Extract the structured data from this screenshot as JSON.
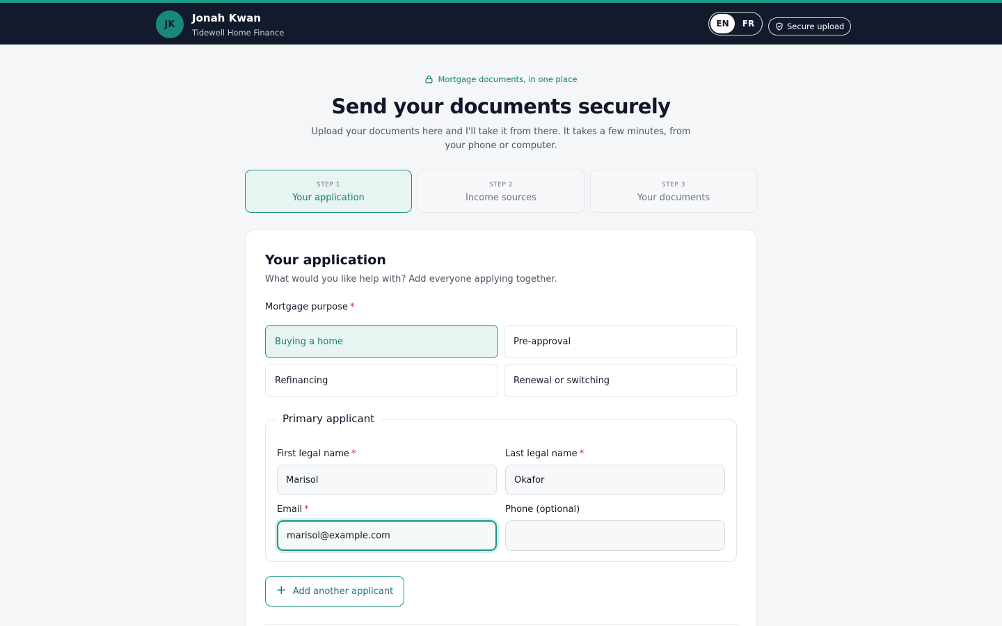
{
  "header": {
    "avatar_initials": "JK",
    "user_name": "Jonah Kwan",
    "user_org": "Tidewell Home Finance",
    "languages": [
      "EN",
      "FR"
    ],
    "active_language": "EN",
    "secure_label": "Secure upload",
    "accent_color": "#1f9e8d",
    "background_color": "#131a2b"
  },
  "hero": {
    "eyebrow": "Mortgage documents, in one place",
    "title": "Send your documents securely",
    "subtitle": "Upload your documents here and I'll take it from there. It takes a few minutes, from your phone or computer."
  },
  "steps": [
    {
      "number": "STEP 1",
      "label": "Your application",
      "active": true
    },
    {
      "number": "STEP 2",
      "label": "Income sources",
      "active": false
    },
    {
      "number": "STEP 3",
      "label": "Your documents",
      "active": false
    }
  ],
  "form": {
    "title": "Your application",
    "subtitle": "What would you like help with? Add everyone applying together.",
    "purpose_label": "Mortgage purpose",
    "required_marker": "*",
    "purpose_options": [
      {
        "label": "Buying a home",
        "selected": true
      },
      {
        "label": "Pre-approval",
        "selected": false
      },
      {
        "label": "Refinancing",
        "selected": false
      },
      {
        "label": "Renewal or switching",
        "selected": false
      }
    ],
    "applicant_legend": "Primary applicant",
    "first_name_label": "First legal name",
    "first_name_value": "Marisol",
    "last_name_label": "Last legal name",
    "last_name_value": "Okafor",
    "email_label": "Email",
    "email_value": "marisol@example.com",
    "phone_label": "Phone (optional)",
    "phone_value": "",
    "add_applicant_label": "Add another applicant"
  }
}
